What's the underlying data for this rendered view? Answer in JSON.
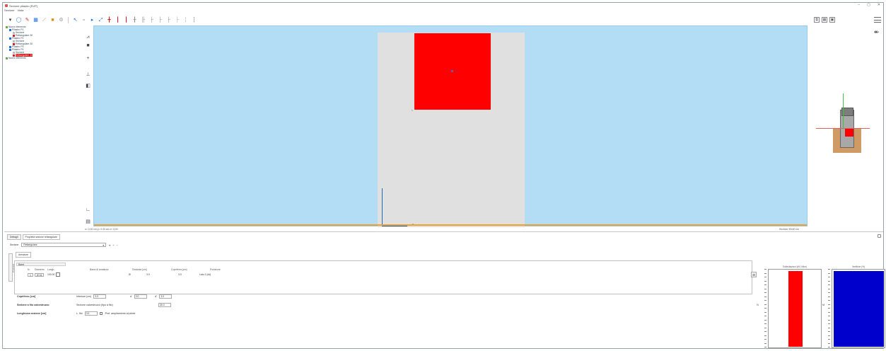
{
  "window": {
    "title": "Sezione pilastro [SVP]",
    "controls": [
      "‒",
      "▢",
      "✕"
    ]
  },
  "menu": {
    "items": [
      "Sezione",
      "Vista"
    ]
  },
  "toolbar": {
    "left": [
      {
        "icon": "dropdown-arrow-icon",
        "glyph": "▾",
        "color": "#333333"
      },
      {
        "icon": "circle-icon",
        "glyph": "◯",
        "color": "#1e6fd9"
      },
      {
        "icon": "pencil-icon",
        "glyph": "✎",
        "color": "#d62020"
      },
      {
        "icon": "grid-icon",
        "glyph": "▦",
        "color": "#1e6fd9"
      },
      {
        "icon": "ruler-icon",
        "glyph": "⟋",
        "color": "#888888"
      },
      {
        "icon": "material-icon",
        "glyph": "■",
        "color": "#e08a1a"
      },
      {
        "icon": "settings-icon",
        "glyph": "⚙",
        "color": "#999999"
      }
    ],
    "middle": [
      {
        "icon": "cursor-icon",
        "glyph": "↖",
        "color": "#1e6fd9"
      },
      {
        "icon": "select-icon",
        "glyph": "▫",
        "color": "#444444"
      },
      {
        "icon": "arrow-right-icon",
        "glyph": "▸",
        "color": "#1e6fd9"
      },
      {
        "icon": "measure-icon",
        "glyph": "⤢",
        "color": "#1e6fd9"
      },
      {
        "icon": "rebar-add-icon",
        "glyph": "╋",
        "color": "#d62020"
      },
      {
        "icon": "rebar-left-icon",
        "glyph": "┃",
        "color": "#d62020"
      },
      {
        "icon": "rebar-right-icon",
        "glyph": "┃",
        "color": "#d62020"
      },
      {
        "icon": "rebar-center-icon",
        "glyph": "╂",
        "color": "#888888"
      },
      {
        "icon": "stirrup-icon",
        "glyph": "╟",
        "color": "#888888"
      },
      {
        "icon": "stirrup-2-icon",
        "glyph": "├",
        "color": "#888888"
      },
      {
        "icon": "stirrup-3-icon",
        "glyph": "├",
        "color": "#888888"
      },
      {
        "icon": "stirrup-4-icon",
        "glyph": "├",
        "color": "#888888"
      },
      {
        "icon": "stirrup-5-icon",
        "glyph": "├",
        "color": "#aaaaaa"
      },
      {
        "icon": "stirrup-6-icon",
        "glyph": "╎",
        "color": "#aaaaaa"
      },
      {
        "icon": "stirrup-7-icon",
        "glyph": "┇",
        "color": "#aaaaaa"
      }
    ],
    "right": [
      {
        "icon": "view-3d-icon",
        "glyph": "⧉"
      },
      {
        "icon": "view-grid-icon",
        "glyph": "▦"
      },
      {
        "icon": "view-panel-icon",
        "glyph": "▣"
      }
    ],
    "nav_arrow": "↞"
  },
  "tree": {
    "items": [
      {
        "label": "Nuovo elemento",
        "level": 0,
        "icon_color": "#6aa84f",
        "selected": false
      },
      {
        "label": "Pilastro P1",
        "level": 1,
        "icon_color": "#1e6fd9",
        "selected": false
      },
      {
        "label": "Sezione",
        "level": 2,
        "icon_color": "#bbbbbb",
        "selected": false
      },
      {
        "label": "Rettangolare 30",
        "level": 2,
        "icon_color": "#d62020",
        "selected": false
      },
      {
        "label": "Pilastro P2",
        "level": 1,
        "icon_color": "#1e6fd9",
        "selected": false
      },
      {
        "label": "Sezione",
        "level": 2,
        "icon_color": "#bbbbbb",
        "selected": false
      },
      {
        "label": "Rettangolare 30",
        "level": 2,
        "icon_color": "#d62020",
        "selected": false
      },
      {
        "label": "Pilastro P3",
        "level": 1,
        "icon_color": "#1e6fd9",
        "selected": false
      },
      {
        "label": "Pilastro P4",
        "level": 1,
        "icon_color": "#1e6fd9",
        "selected": false
      },
      {
        "label": "Sezione",
        "level": 2,
        "icon_color": "#bbbbbb",
        "selected": false
      },
      {
        "label": "Rettangolare 30",
        "level": 2,
        "icon_color": "#d62020",
        "selected": true
      },
      {
        "label": "Nuovo elemento",
        "level": 0,
        "icon_color": "#6aa84f",
        "selected": false
      }
    ]
  },
  "vertical_tools": [
    {
      "icon": "draw-icon",
      "glyph": "⩘"
    },
    {
      "icon": "fill-icon",
      "glyph": "■"
    },
    {
      "icon": "plus-icon",
      "glyph": "+"
    },
    {
      "icon": "pin-icon",
      "glyph": "⊥"
    },
    {
      "icon": "layers-icon",
      "glyph": "◧"
    },
    {
      "icon": "axis-icon",
      "glyph": "∟"
    },
    {
      "icon": "export-icon",
      "glyph": "▤"
    }
  ],
  "viewport": {
    "axis_x_label": "x",
    "point_label": "G"
  },
  "status": {
    "left": "x= 0.00 cm  y= 0.00 cm  z= 0.00",
    "right": "Sezione 30x30 cm"
  },
  "bottom": {
    "tabs": [
      "Dettagli",
      "Proprietà sezione rettangolare"
    ],
    "selector_label": "Sezione",
    "selector_value": "Rettangolare",
    "mini_controls": [
      "▾",
      "+",
      "−"
    ],
    "side_tab": "Proprietà",
    "inner_tab": "Armature",
    "group_header": "Barre",
    "columns": [
      "N.",
      "Diametro",
      "Lungh.",
      "Barra di armatura",
      "Distanza [cm]",
      "Copriferro [cm]",
      "Posizione"
    ],
    "row": {
      "n": "1",
      "diam": "Ø 16",
      "len": "100.00",
      "bar": "Ø",
      "dist": "3.0",
      "cover": "3.0",
      "pos": "Lato 1 (dx)"
    },
    "group_side_glyph": "⊞",
    "props": [
      {
        "label": "Copriferro [cm]",
        "fields": [
          {
            "text": "Inferiore (cm)",
            "value": "3.0"
          },
          {
            "text": "d'",
            "value": "3.0"
          },
          {
            "text": "d''",
            "value": "3.0"
          }
        ]
      },
      {
        "label": "Sezione a filo calcestruzzo",
        "fields": [
          {
            "text": "Sezione calcestruzzo (tipo a filo)",
            "value": "30.0"
          }
        ]
      },
      {
        "label": "Lunghezza sezione [cm]",
        "fields": [
          {
            "text": "L. filo",
            "value": "0.0"
          }
        ],
        "checkbox": "Prof. ampliamento al piede"
      }
    ],
    "chart1_title": "Sollecitazioni (kN, kNm)",
    "chart2_title": "Verifiche (%)",
    "chart_tag1": "N",
    "chart_tag2": "M"
  },
  "chart_data": [
    {
      "type": "bar",
      "title": "Sollecitazioni (kN, kNm)",
      "categories": [
        ""
      ],
      "values": [
        0.97
      ],
      "ylim": [
        0,
        1
      ],
      "color": "#ff0000"
    },
    {
      "type": "bar",
      "title": "Verifiche (%)",
      "categories": [
        ""
      ],
      "values": [
        0.97
      ],
      "ylim": [
        0,
        1
      ],
      "color": "#0000cc"
    }
  ]
}
